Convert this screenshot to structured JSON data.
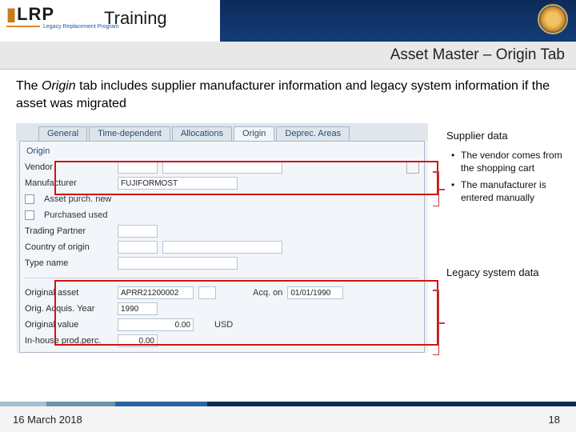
{
  "header": {
    "logo_main": "LRP",
    "logo_sub": "Legacy Replacement Program",
    "title": "Training",
    "subtitle": "Asset Master – Origin Tab"
  },
  "intro": {
    "prefix": "The ",
    "em": "Origin",
    "rest": " tab includes supplier manufacturer information and legacy system information if the asset was migrated"
  },
  "sap": {
    "tabs": [
      "General",
      "Time-dependent",
      "Allocations",
      "Origin",
      "Deprec. Areas"
    ],
    "active_tab_index": 3,
    "group_title": "Origin",
    "rows": {
      "vendor_label": "Vendor",
      "vendor_value": "",
      "manufacturer_label": "Manufacturer",
      "manufacturer_value": "FUJIFORMOST",
      "asset_purch_label": "Asset purch. new",
      "purchased_used_label": "Purchased used",
      "trading_partner_label": "Trading Partner",
      "country_label": "Country of origin",
      "type_label": "Type name",
      "orig_asset_label": "Original asset",
      "orig_asset_value": "APRR21200002",
      "acq_on_label": "Acq. on",
      "acq_on_value": "01/01/1990",
      "orig_year_label": "Orig. Acquis. Year",
      "orig_year_value": "1990",
      "orig_value_label": "Original value",
      "orig_value_amount": "0.00",
      "orig_value_curr": "USD",
      "inhouse_label": "In-house prod.perc.",
      "inhouse_value": "0.00"
    }
  },
  "sidebar": {
    "heading1": "Supplier data",
    "bullets": [
      "The vendor comes from the shopping cart",
      "The manufacturer is entered manually"
    ],
    "heading2": "Legacy system data"
  },
  "footer": {
    "date": "16 March 2018",
    "page": "18"
  }
}
